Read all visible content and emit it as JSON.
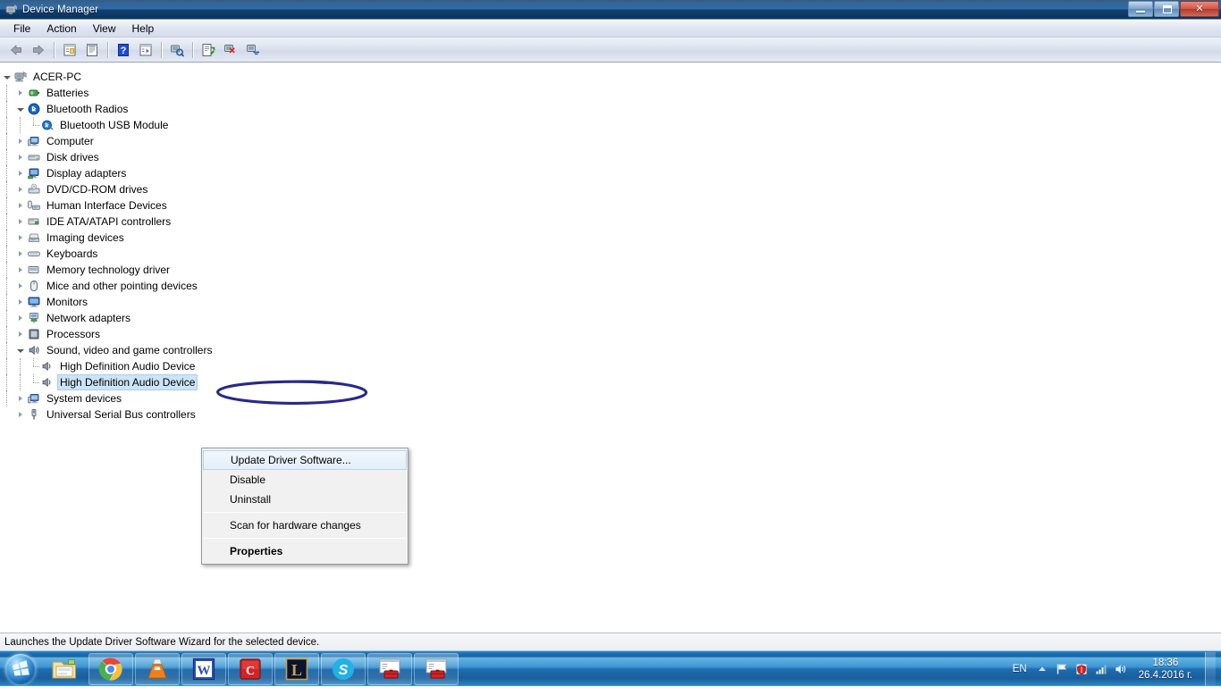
{
  "window": {
    "title": "Device Manager",
    "title_icon": "device-manager-icon",
    "buttons": {
      "minimize": "Minimize",
      "maximize": "Maximize",
      "close": "Close"
    }
  },
  "menubar": {
    "items": [
      {
        "label": "File"
      },
      {
        "label": "Action"
      },
      {
        "label": "View"
      },
      {
        "label": "Help"
      }
    ]
  },
  "toolbar": {
    "buttons": [
      {
        "name": "back-icon",
        "tip": "Back"
      },
      {
        "name": "forward-icon",
        "tip": "Forward"
      },
      {
        "name": "show-hide-console-tree-icon",
        "tip": "Show/Hide Console Tree"
      },
      {
        "name": "properties-icon",
        "tip": "Properties"
      },
      {
        "name": "help-icon",
        "tip": "Help"
      },
      {
        "name": "show-hide-action-pane-icon",
        "tip": "Show/Hide Action Pane"
      },
      {
        "name": "scan-for-hardware-changes-icon",
        "tip": "Scan for hardware changes"
      },
      {
        "name": "update-driver-software-icon",
        "tip": "Update Driver Software"
      },
      {
        "name": "disable-device-icon",
        "tip": "Disable"
      },
      {
        "name": "uninstall-device-icon",
        "tip": "Uninstall"
      }
    ]
  },
  "tree": {
    "root": {
      "label": "ACER-PC",
      "icon": "computer-root-icon"
    },
    "nodes": [
      {
        "label": "Batteries",
        "icon": "battery-icon",
        "level": 1,
        "state": "collapsed"
      },
      {
        "label": "Bluetooth Radios",
        "icon": "bluetooth-icon",
        "level": 1,
        "state": "expanded"
      },
      {
        "label": "Bluetooth USB Module",
        "icon": "bluetooth-device-icon",
        "level": 2,
        "state": "leaf"
      },
      {
        "label": "Computer",
        "icon": "computer-icon",
        "level": 1,
        "state": "collapsed"
      },
      {
        "label": "Disk drives",
        "icon": "disk-drive-icon",
        "level": 1,
        "state": "collapsed"
      },
      {
        "label": "Display adapters",
        "icon": "display-adapter-icon",
        "level": 1,
        "state": "collapsed"
      },
      {
        "label": "DVD/CD-ROM drives",
        "icon": "dvd-drive-icon",
        "level": 1,
        "state": "collapsed"
      },
      {
        "label": "Human Interface Devices",
        "icon": "hid-icon",
        "level": 1,
        "state": "collapsed"
      },
      {
        "label": "IDE ATA/ATAPI controllers",
        "icon": "ide-controller-icon",
        "level": 1,
        "state": "collapsed"
      },
      {
        "label": "Imaging devices",
        "icon": "imaging-device-icon",
        "level": 1,
        "state": "collapsed"
      },
      {
        "label": "Keyboards",
        "icon": "keyboard-icon",
        "level": 1,
        "state": "collapsed"
      },
      {
        "label": "Memory technology driver",
        "icon": "memory-technology-icon",
        "level": 1,
        "state": "collapsed"
      },
      {
        "label": "Mice and other pointing devices",
        "icon": "mouse-icon",
        "level": 1,
        "state": "collapsed"
      },
      {
        "label": "Monitors",
        "icon": "monitor-icon",
        "level": 1,
        "state": "collapsed"
      },
      {
        "label": "Network adapters",
        "icon": "network-adapter-icon",
        "level": 1,
        "state": "collapsed"
      },
      {
        "label": "Processors",
        "icon": "processor-icon",
        "level": 1,
        "state": "collapsed"
      },
      {
        "label": "Sound, video and game controllers",
        "icon": "sound-controller-icon",
        "level": 1,
        "state": "expanded"
      },
      {
        "label": "High Definition Audio Device",
        "icon": "sound-device-icon",
        "level": 2,
        "state": "leaf"
      },
      {
        "label": "High Definition Audio Device",
        "icon": "sound-device-icon",
        "level": 2,
        "state": "leaf",
        "selected": true
      },
      {
        "label": "System devices",
        "icon": "system-device-icon",
        "level": 1,
        "state": "collapsed"
      },
      {
        "label": "Universal Serial Bus controllers",
        "icon": "usb-controller-icon",
        "level": 1,
        "state": "collapsed"
      }
    ]
  },
  "context_menu": {
    "items": [
      {
        "label": "Update Driver Software...",
        "highlighted": true,
        "bold": false
      },
      {
        "label": "Disable",
        "highlighted": false,
        "bold": false
      },
      {
        "label": "Uninstall",
        "highlighted": false,
        "bold": false
      },
      {
        "separator": true
      },
      {
        "label": "Scan for hardware changes",
        "highlighted": false,
        "bold": false
      },
      {
        "separator": true
      },
      {
        "label": "Properties",
        "highlighted": false,
        "bold": true
      }
    ]
  },
  "annotation": {
    "shape": "ellipse",
    "color": "#28288c",
    "target": "Update Driver Software..."
  },
  "statusbar": {
    "text": "Launches the Update Driver Software Wizard for the selected device."
  },
  "taskbar": {
    "start_button": "start-orb",
    "items": [
      {
        "name": "windows-explorer-icon",
        "label": "Windows Explorer",
        "pinned": true
      },
      {
        "name": "google-chrome-icon",
        "label": "Google Chrome",
        "pinned": true
      },
      {
        "name": "vlc-media-player-icon",
        "label": "VLC media player",
        "pinned": true
      },
      {
        "name": "microsoft-word-icon",
        "label": "Microsoft Word",
        "pinned": false
      },
      {
        "name": "app-c-icon",
        "label": "C",
        "pinned": false
      },
      {
        "name": "league-of-legends-icon",
        "label": "League of Legends",
        "pinned": false
      },
      {
        "name": "skype-icon",
        "label": "Skype",
        "pinned": false
      },
      {
        "name": "device-manager-window-icon",
        "label": "Device Manager",
        "pinned": false
      },
      {
        "name": "device-manager-window-icon-2",
        "label": "Device Manager",
        "pinned": false
      }
    ],
    "tray": {
      "language": "EN",
      "icons": [
        {
          "name": "show-hidden-icons-arrow-icon"
        },
        {
          "name": "flag-action-center-icon"
        },
        {
          "name": "antivirus-shield-icon"
        },
        {
          "name": "network-signal-icon"
        },
        {
          "name": "volume-icon"
        }
      ],
      "time": "18:36",
      "date": "26.4.2016 г."
    }
  },
  "colors": {
    "titlebar": "#17518c",
    "selection": "#cce4f7",
    "taskbar": "#2f86c4",
    "annotation": "#28288c",
    "menu_bg": "#f1f1f1"
  }
}
